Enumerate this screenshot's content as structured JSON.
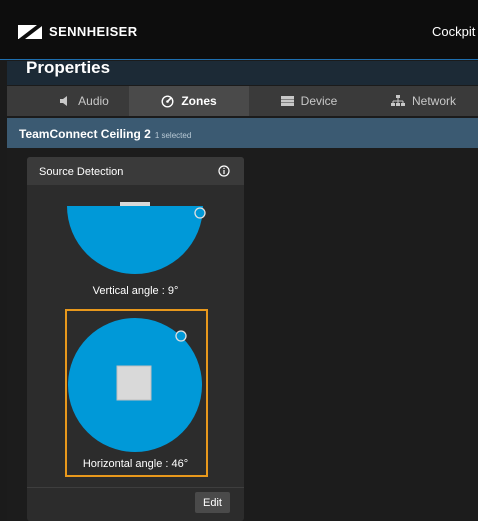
{
  "app": {
    "brand": "SENNHEISER",
    "title": "Cockpit"
  },
  "properties": {
    "title": "Properties"
  },
  "tabs": [
    {
      "label": "Audio",
      "icon": "speaker-icon",
      "active": false
    },
    {
      "label": "Zones",
      "icon": "zones-gauge-icon",
      "active": true
    },
    {
      "label": "Device",
      "icon": "device-icon",
      "active": false
    },
    {
      "label": "Network",
      "icon": "network-icon",
      "active": false
    }
  ],
  "device": {
    "name": "TeamConnect Ceiling 2",
    "selection": "1 selected"
  },
  "source_detection": {
    "title": "Source Detection",
    "info_icon": "info-icon",
    "vertical_label": "Vertical angle : 9°",
    "horizontal_label": "Horizontal angle : 46°",
    "edit_label": "Edit"
  },
  "colors": {
    "accent_blue": "#0099d8",
    "highlight_orange": "#e8981c",
    "device_bar": "#3b5a72"
  }
}
